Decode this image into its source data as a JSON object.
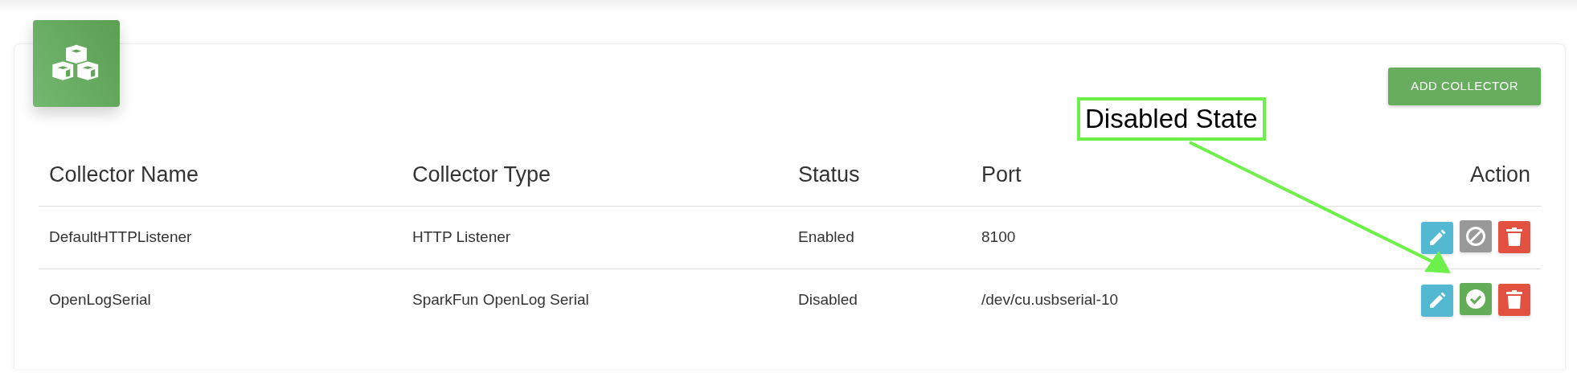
{
  "header": {
    "kind": "cubes"
  },
  "add_button": {
    "label": "ADD COLLECTOR"
  },
  "table": {
    "columns": [
      "Collector Name",
      "Collector Type",
      "Status",
      "Port",
      "Action"
    ],
    "rows": [
      {
        "name": "DefaultHTTPListener",
        "type": "HTTP Listener",
        "status": "Enabled",
        "port": "8100",
        "enabled": true
      },
      {
        "name": "OpenLogSerial",
        "type": "SparkFun OpenLog Serial",
        "status": "Disabled",
        "port": "/dev/cu.usbserial-10",
        "enabled": false
      }
    ]
  },
  "annotation": {
    "label": "Disabled State"
  }
}
